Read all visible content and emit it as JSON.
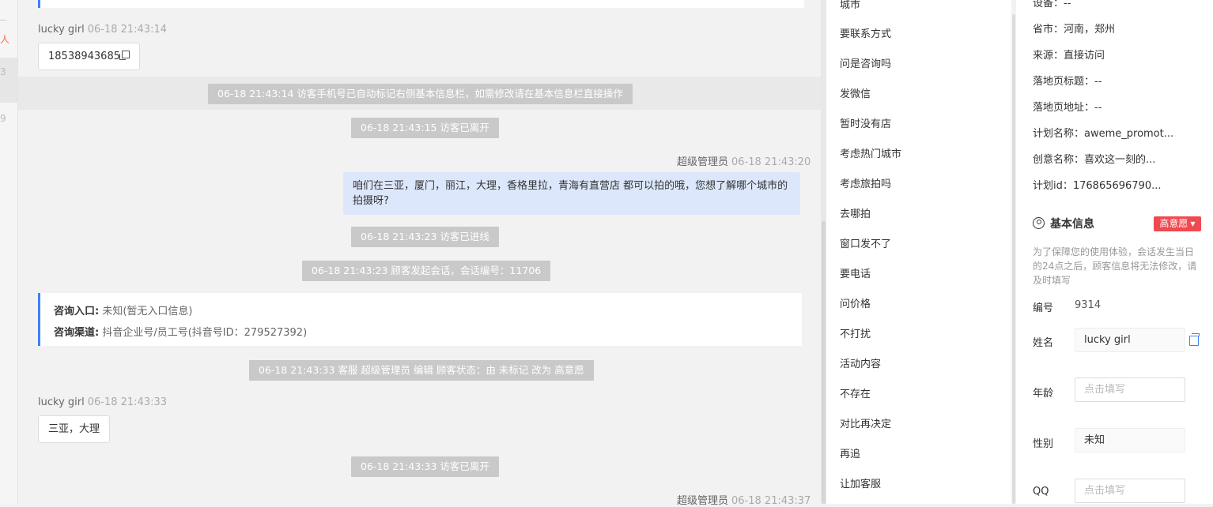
{
  "left_strip": {
    "fragment_1": "人",
    "fragment_2": "3",
    "fragment_3": "9"
  },
  "chat": {
    "msg1": {
      "sender": "lucky girl",
      "time": "06-18 21:43:14",
      "text": "18538943685"
    },
    "sys1": "06-18 21:43:14 访客手机号已自动标记右侧基本信息栏，如需修改请在基本信息栏直接操作",
    "sys2": "06-18 21:43:15 访客已离开",
    "msg2": {
      "sender": "超级管理员",
      "time": "06-18 21:43:20",
      "text": "咱们在三亚，厦门，丽江，大理，香格里拉，青海有直营店 都可以拍的哦，您想了解哪个城市的拍摄呀?"
    },
    "sys3": "06-18 21:43:23 访客已进线",
    "sys4": "06-18 21:43:23 顾客发起会话，会话编号：11706",
    "entry_card": {
      "entry_label": "咨询入口:",
      "entry_value": "未知(暂无入口信息)",
      "channel_label": "咨询渠道:",
      "channel_value": "抖音企业号/员工号(抖音号ID：279527392)"
    },
    "sys5": "06-18 21:43:33 客服 超级管理员 编辑 顾客状态：由 未标记 改为 高意愿",
    "msg3": {
      "sender": "lucky girl",
      "time": "06-18 21:43:33",
      "text": "三亚，大理"
    },
    "sys6": "06-18 21:43:33 访客已离开",
    "msg4": {
      "sender": "超级管理员",
      "time": "06-18 21:43:37"
    }
  },
  "quick_replies": [
    "城市",
    "要联系方式",
    "问是咨询吗",
    "发微信",
    "暂时没有店",
    "考虑热门城市",
    "考虑旅拍吗",
    "去哪拍",
    "窗口发不了",
    "要电话",
    "问价格",
    "不打扰",
    "活动内容",
    "不存在",
    "对比再决定",
    "再追",
    "让加客服"
  ],
  "visitor": {
    "device": "设备：--",
    "province": "省市：河南，郑州",
    "source": "来源：直接访问",
    "landing_title": "落地页标题：--",
    "landing_url": "落地页地址：--",
    "plan_name": "计划名称：aweme_promot...",
    "creative_name": "创意名称：喜欢这一刻的...",
    "plan_id": "计划id：176865696790..."
  },
  "basic_info": {
    "title": "基本信息",
    "intent_badge": "高意愿",
    "note": "为了保障您的使用体验，会话发生当日的24点之后，顾客信息将无法修改，请及时填写",
    "id_label": "编号",
    "id_value": "9314",
    "name_label": "姓名",
    "name_value": "lucky girl",
    "age_label": "年龄",
    "age_placeholder": "点击填写",
    "gender_label": "性别",
    "gender_value": "未知",
    "qq_label": "QQ",
    "qq_placeholder": "点击填写"
  },
  "colors": {
    "accent": "#3f7ff5",
    "badge_red": "#f0494f",
    "outgoing_bubble": "#dde7fb",
    "system_chip": "#c9c9c9"
  }
}
